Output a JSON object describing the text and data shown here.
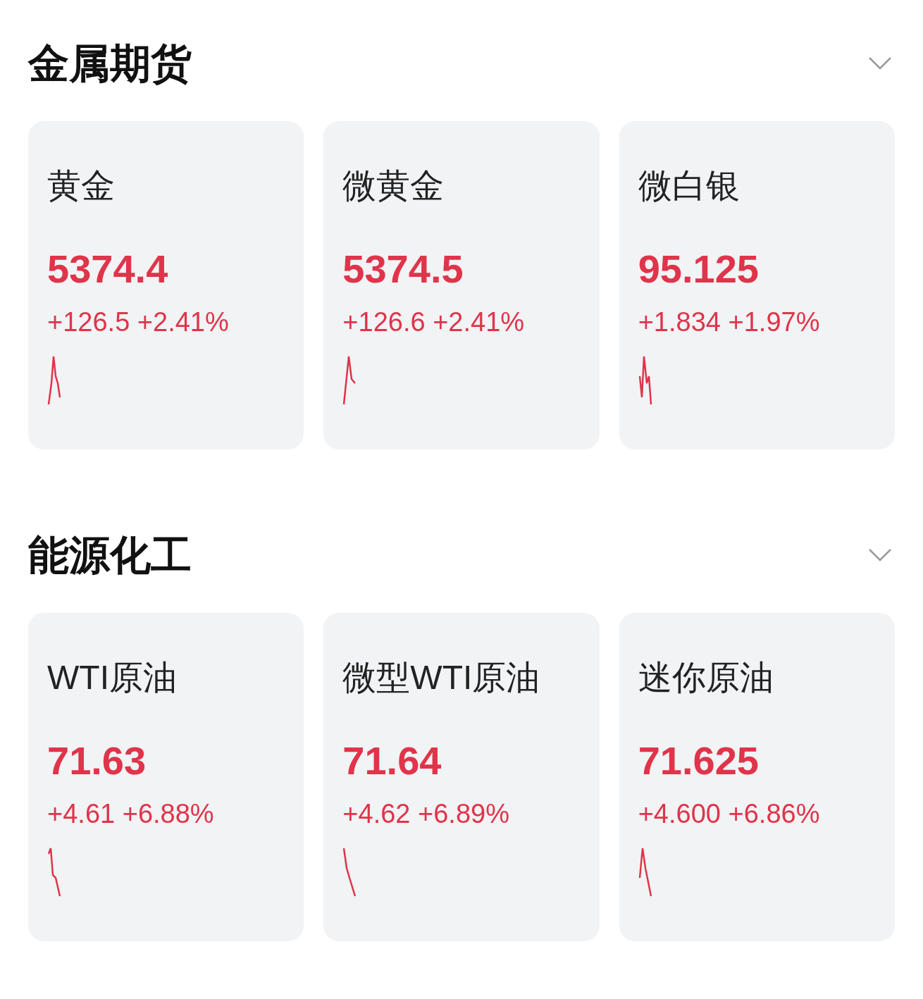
{
  "sections": [
    {
      "title": "金属期货",
      "items": [
        {
          "name": "黄金",
          "price": "5374.4",
          "change": "+126.5 +2.41%"
        },
        {
          "name": "微黄金",
          "price": "5374.5",
          "change": "+126.6 +2.41%"
        },
        {
          "name": "微白银",
          "price": "95.125",
          "change": "+1.834 +1.97%"
        }
      ]
    },
    {
      "title": "能源化工",
      "items": [
        {
          "name": "WTI原油",
          "price": "71.63",
          "change": "+4.61 +6.88%"
        },
        {
          "name": "微型WTI原油",
          "price": "71.64",
          "change": "+4.62 +6.89%"
        },
        {
          "name": "迷你原油",
          "price": "71.625",
          "change": "+4.600 +6.86%"
        }
      ]
    }
  ]
}
